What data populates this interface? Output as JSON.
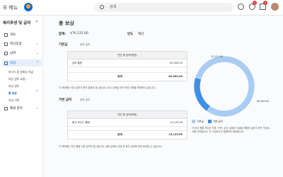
{
  "topbar": {
    "menu_label": "메뉴",
    "search_value": "검색",
    "notif_count": "1",
    "inbox_count": "3"
  },
  "sidebar": {
    "title": "복리후생 및 급여",
    "items": [
      {
        "label": "개요"
      },
      {
        "label": "복리후생"
      },
      {
        "label": "급여"
      },
      {
        "label": "보상"
      },
      {
        "label": "폐쇄 항목"
      }
    ],
    "sub_items": [
      {
        "label": "보너스 및 일회성 지급"
      },
      {
        "label": "보상 검토 요청..."
      },
      {
        "label": "보상 검토"
      },
      {
        "label": "총 보상"
      },
      {
        "label": "보상 기록"
      }
    ]
  },
  "main": {
    "title": "총 보상",
    "total_label": "합계:",
    "total_value": "$76,125.00",
    "period_label": "빈도",
    "period_value": "매년",
    "base": {
      "section": "기본급",
      "section_sub": "참여 급여",
      "header": "연간 총 금액(목표)",
      "row_label": "급여 플랜",
      "row_value": "60,000.00",
      "total_label": "합계:",
      "total_value": "60,000.00",
      "note": "이 섹션에는 연간 급여가 현지 통화로 표시됩니다. 표시 금액은 모든 조정 사항을 포함하지 않습니다."
    },
    "variable": {
      "section": "가변 급여",
      "section_sub": "참여 급여",
      "header": "연간 총 금액(목표)",
      "row_label": "회사 보너스 플랜",
      "row_value": "15,125.00",
      "total_label": "합계:",
      "total_value": "15,125.00",
      "note": "이 섹션에는 연간 통화 기준 급여가 표시됩니다. 실제 금액은 성과 및 회사 실적에 따라 달라질 수 있습니다."
    },
    "chart_note": "이 보상 현황 차트는 기본, 가변, 수당, 일회성 지급을 포함한 급여의 모든 구성요소를 나타냅니다. 각 구성요소는 통합되어 제공됩니다."
  },
  "chart_data": {
    "type": "pie",
    "series": [
      {
        "name": "기본급",
        "value": 60000,
        "label": "60,000.00"
      },
      {
        "name": "가변 급여",
        "value": 15125,
        "label": "15,125.00"
      }
    ],
    "colors": [
      "#a9cdf2",
      "#3f8fe6"
    ]
  },
  "colors": {
    "accent": "#0a65d8"
  }
}
